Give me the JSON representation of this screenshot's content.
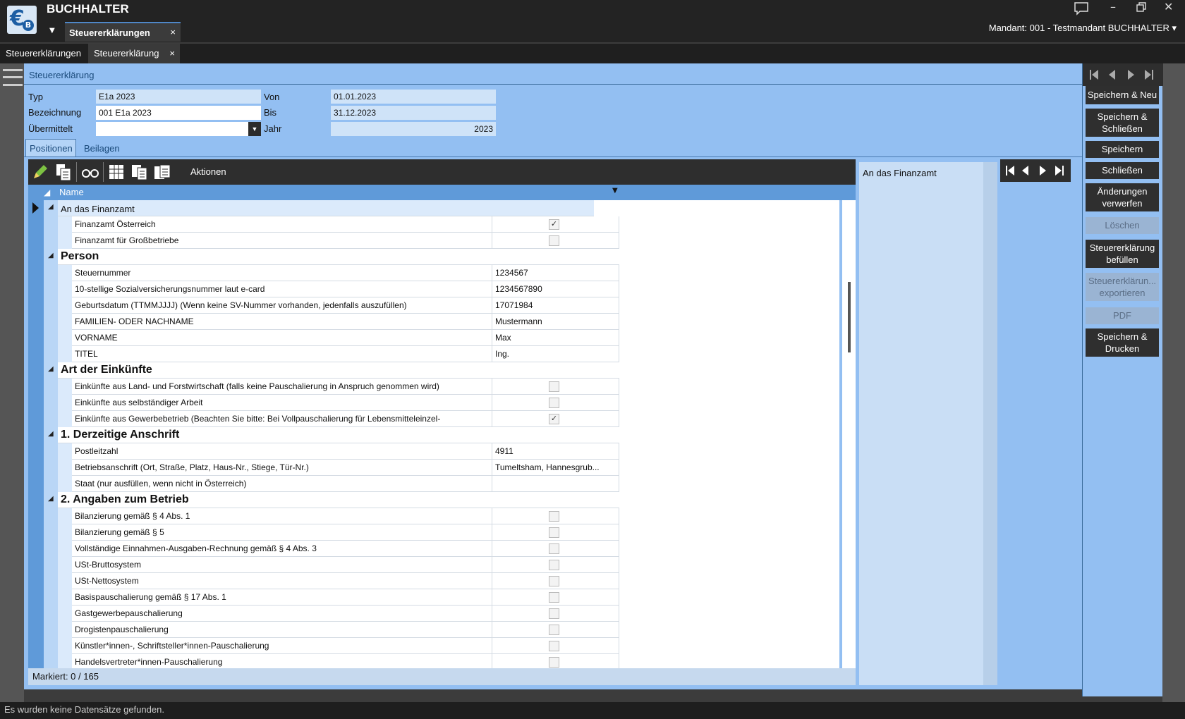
{
  "app": {
    "title": "BUCHHALTER",
    "logo_text": "B"
  },
  "top_tab": {
    "label": "Steuererklärungen",
    "close": "×"
  },
  "mandant": "Mandant: 001 - Testmandant BUCHHALTER",
  "sub_tabs": [
    {
      "label": "Steuererklärungen"
    },
    {
      "label": "Steuererklärung",
      "close": "×"
    }
  ],
  "form": {
    "header": "Steuererklärung",
    "typ_label": "Typ",
    "typ_value": "E1a 2023",
    "bezeichnung_label": "Bezeichnung",
    "bezeichnung_value": "001 E1a 2023",
    "uebermittelt_label": "Übermittelt",
    "uebermittelt_value": "",
    "von_label": "Von",
    "von_value": "01.01.2023",
    "bis_label": "Bis",
    "bis_value": "31.12.2023",
    "jahr_label": "Jahr",
    "jahr_value": "2023"
  },
  "tabs": [
    {
      "label": "Positionen"
    },
    {
      "label": "Beilagen"
    }
  ],
  "toolbar": {
    "actions_label": "Aktionen"
  },
  "grid": {
    "column_name": "Name",
    "status": "Markiert: 0 / 165",
    "groups": {
      "finanzamt": "An das Finanzamt",
      "person": "Person",
      "einkuenfte": "Art der Einkünfte",
      "anschrift": "1. Derzeitige Anschrift",
      "betrieb": "2. Angaben zum Betrieb"
    },
    "finanzamt_rows": [
      {
        "label": "Finanzamt Österreich",
        "checked": "✓"
      },
      {
        "label": "Finanzamt für Großbetriebe",
        "checked": ""
      }
    ],
    "person_rows": [
      {
        "label": "Steuernummer",
        "value": "1234567"
      },
      {
        "label": "10-stellige Sozialversicherungsnummer laut e-card",
        "value": "1234567890"
      },
      {
        "label": "Geburtsdatum (TTMMJJJJ) (Wenn keine SV-Nummer vorhanden, jedenfalls auszufüllen)",
        "value": "17071984"
      },
      {
        "label": "FAMILIEN- ODER NACHNAME",
        "value": "Mustermann"
      },
      {
        "label": "VORNAME",
        "value": "Max"
      },
      {
        "label": "TITEL",
        "value": "Ing."
      }
    ],
    "einkuenfte_rows": [
      {
        "label": "Einkünfte aus Land- und Forstwirtschaft (falls keine Pauschalierung in Anspruch genommen wird)",
        "checked": ""
      },
      {
        "label": "Einkünfte aus selbständiger Arbeit",
        "checked": ""
      },
      {
        "label": "Einkünfte aus Gewerbebetrieb (Beachten Sie bitte: Bei Vollpauschalierung für Lebensmitteleinzel-",
        "checked": "✓"
      }
    ],
    "anschrift_rows": [
      {
        "label": "Postleitzahl",
        "value": "4911"
      },
      {
        "label": "Betriebsanschrift (Ort, Straße, Platz, Haus-Nr., Stiege, Tür-Nr.)",
        "value": "Tumeltsham, Hannesgrub..."
      },
      {
        "label": "Staat (nur ausfüllen, wenn nicht in Österreich)",
        "value": ""
      }
    ],
    "betrieb_rows": [
      {
        "label": "Bilanzierung gemäß § 4 Abs. 1",
        "checked": ""
      },
      {
        "label": "Bilanzierung gemäß § 5",
        "checked": ""
      },
      {
        "label": "Vollständige Einnahmen-Ausgaben-Rechnung gemäß § 4 Abs. 3",
        "checked": ""
      },
      {
        "label": "USt-Bruttosystem",
        "checked": ""
      },
      {
        "label": "USt-Nettosystem",
        "checked": ""
      },
      {
        "label": "Basispauschalierung gemäß § 17 Abs. 1",
        "checked": ""
      },
      {
        "label": "Gastgewerbepauschalierung",
        "checked": ""
      },
      {
        "label": "Drogistenpauschalierung",
        "checked": ""
      },
      {
        "label": "Künstler*innen-, Schriftsteller*innen-Pauschalierung",
        "checked": ""
      },
      {
        "label": "Handelsvertreter*innen-Pauschalierung",
        "checked": ""
      }
    ]
  },
  "detail": {
    "text": "An das Finanzamt"
  },
  "actions": {
    "speichern_neu": "Speichern & Neu",
    "speichern_schliessen": "Speichern & Schließen",
    "speichern": "Speichern",
    "schliessen": "Schließen",
    "aenderungen_verwerfen": "Änderungen verwerfen",
    "loeschen": "Löschen",
    "befuellen": "Steuererklärung befüllen",
    "exportieren": "Steuererklärun... exportieren",
    "pdf": "PDF",
    "speichern_drucken": "Speichern & Drucken"
  },
  "bottom_status": "Es wurden keine Datensätze gefunden.",
  "colors": {
    "panel": "#93bff2",
    "grid_header": "#5f9ad9",
    "dark": "#232323"
  }
}
